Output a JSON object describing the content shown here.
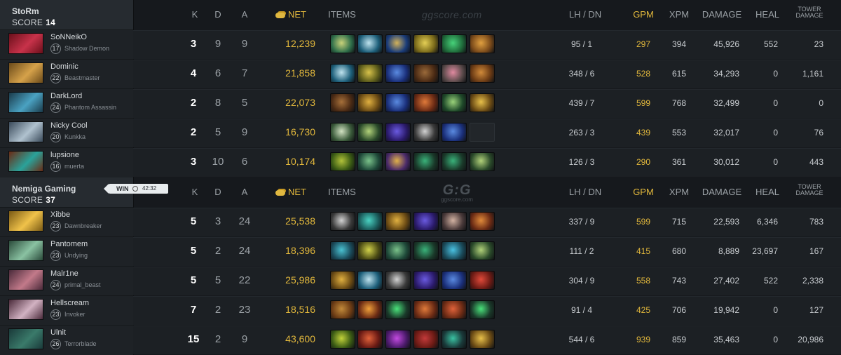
{
  "headers": {
    "k": "K",
    "d": "D",
    "a": "A",
    "net": "NET",
    "items": "ITEMS",
    "lhdn": "LH / DN",
    "gpm": "GPM",
    "xpm": "XPM",
    "damage": "DAMAGE",
    "heal": "HEAL",
    "tower_l1": "TOWER",
    "tower_l2": "DAMAGE"
  },
  "watermark": {
    "top": "ggscore.com",
    "logo": "G:G",
    "logo_sub": "ggscore.com"
  },
  "result": {
    "label": "WIN",
    "time": "42:32"
  },
  "teams": [
    {
      "name": "StoRm",
      "score_label": "SCORE",
      "score": "14",
      "players": [
        {
          "name": "SoNNeikO",
          "level": "17",
          "hero": "Shadow Demon",
          "k": "3",
          "d": "9",
          "a": "9",
          "net": "12,239",
          "lhdn": "95 / 1",
          "gpm": "297",
          "xpm": "394",
          "damage": "45,926",
          "heal": "552",
          "tower": "23",
          "avatar": [
            "#6a0f1a",
            "#c8324a"
          ],
          "items": [
            [
              "#2f6e4a",
              "#c9d27a"
            ],
            [
              "#1d5f7a",
              "#bfe3ee"
            ],
            [
              "#1a3c7a",
              "#d2b25a"
            ],
            [
              "#7a6a1a",
              "#e4cf55"
            ],
            [
              "#1f6a3a",
              "#47d27a"
            ],
            [
              "#7a4a1a",
              "#e0a040"
            ]
          ]
        },
        {
          "name": "Dominic",
          "level": "22",
          "hero": "Beastmaster",
          "k": "4",
          "d": "6",
          "a": "7",
          "net": "21,858",
          "lhdn": "348 / 6",
          "gpm": "528",
          "xpm": "615",
          "damage": "34,293",
          "heal": "0",
          "tower": "1,161",
          "avatar": [
            "#6a4a1a",
            "#d6a24a"
          ],
          "items": [
            [
              "#1d5f7a",
              "#bfe3ee"
            ],
            [
              "#5a5a1a",
              "#d7c24a"
            ],
            [
              "#1a2f7a",
              "#5a8ae0"
            ],
            [
              "#4a2a14",
              "#9a6a3a"
            ],
            [
              "#5a4a4a",
              "#e08aa0"
            ],
            [
              "#6a3a14",
              "#d08a3a"
            ]
          ]
        },
        {
          "name": "DarkLord",
          "level": "24",
          "hero": "Phantom Assassin",
          "k": "2",
          "d": "8",
          "a": "5",
          "net": "22,073",
          "lhdn": "439 / 7",
          "gpm": "599",
          "xpm": "768",
          "damage": "32,499",
          "heal": "0",
          "tower": "0",
          "avatar": [
            "#1a3a4a",
            "#4aa2c2"
          ],
          "items": [
            [
              "#4a2a14",
              "#a6703a"
            ],
            [
              "#6a4a14",
              "#e0b040"
            ],
            [
              "#1a2f7a",
              "#5a8ae0"
            ],
            [
              "#6a2a14",
              "#e07a3a"
            ],
            [
              "#1f4a2a",
              "#9ad27a"
            ],
            [
              "#6a4a14",
              "#e8c04a"
            ]
          ]
        },
        {
          "name": "Nicky Cool",
          "level": "20",
          "hero": "Kunkka",
          "k": "2",
          "d": "5",
          "a": "9",
          "net": "16,730",
          "lhdn": "263 / 3",
          "gpm": "439",
          "xpm": "553",
          "damage": "32,017",
          "heal": "0",
          "tower": "76",
          "avatar": [
            "#3a4a5a",
            "#b0c2cf"
          ],
          "items": [
            [
              "#3a5a3a",
              "#d2e2c2"
            ],
            [
              "#2a4a2a",
              "#b2d27a"
            ],
            [
              "#2a1a6a",
              "#6a5ae0"
            ],
            [
              "#3a3a3a",
              "#d2d2d2"
            ],
            [
              "#1a2f7a",
              "#5a8ae0"
            ],
            null
          ]
        },
        {
          "name": "lupsione",
          "level": "16",
          "hero": "muerta",
          "k": "3",
          "d": "10",
          "a": "6",
          "net": "10,174",
          "lhdn": "126 / 3",
          "gpm": "290",
          "xpm": "361",
          "damage": "30,012",
          "heal": "0",
          "tower": "443",
          "avatar": [
            "#6a2a14",
            "#2aa29a"
          ],
          "items": [
            [
              "#3a5a14",
              "#b2c23a"
            ],
            [
              "#1f4a3a",
              "#7ac28a"
            ],
            [
              "#4a2a6a",
              "#e0b04a"
            ],
            [
              "#1a3a2a",
              "#3ab27a"
            ],
            [
              "#1a3a2a",
              "#3ab27a"
            ],
            [
              "#2a4a2a",
              "#b2d27a"
            ]
          ]
        }
      ]
    },
    {
      "name": "Nemiga Gaming",
      "score_label": "SCORE",
      "score": "37",
      "players": [
        {
          "name": "Xibbe",
          "level": "23",
          "hero": "Dawnbreaker",
          "k": "5",
          "d": "3",
          "a": "24",
          "net": "25,538",
          "lhdn": "337 / 9",
          "gpm": "599",
          "xpm": "715",
          "damage": "22,593",
          "heal": "6,346",
          "tower": "783",
          "avatar": [
            "#7a5a14",
            "#f0c24a"
          ],
          "items": [
            [
              "#3a3a3a",
              "#d2d2d2"
            ],
            [
              "#1a5a5a",
              "#4ad2c2"
            ],
            [
              "#6a4a14",
              "#e0b040"
            ],
            [
              "#2a1a6a",
              "#6a5ae0"
            ],
            [
              "#4a3a3a",
              "#d2b2a2"
            ],
            [
              "#6a2a14",
              "#e08a3a"
            ]
          ]
        },
        {
          "name": "Pantomem",
          "level": "23",
          "hero": "Undying",
          "k": "5",
          "d": "2",
          "a": "24",
          "net": "18,396",
          "lhdn": "111 / 2",
          "gpm": "415",
          "xpm": "680",
          "damage": "8,889",
          "heal": "23,697",
          "tower": "167",
          "avatar": [
            "#2a4a3a",
            "#8ac2a2"
          ],
          "items": [
            [
              "#1a4a5a",
              "#4ac2d2"
            ],
            [
              "#4a4a14",
              "#d2d24a"
            ],
            [
              "#1f4a3a",
              "#7ac28a"
            ],
            [
              "#1a3a2a",
              "#3ab27a"
            ],
            [
              "#1a4a5a",
              "#4ac2e2"
            ],
            [
              "#2a4a2a",
              "#b2d27a"
            ]
          ]
        },
        {
          "name": "Malr1ne",
          "level": "24",
          "hero": "primal_beast",
          "k": "5",
          "d": "5",
          "a": "22",
          "net": "25,986",
          "lhdn": "304 / 9",
          "gpm": "558",
          "xpm": "743",
          "damage": "27,402",
          "heal": "522",
          "tower": "2,338",
          "avatar": [
            "#4a2a3a",
            "#c27a8a"
          ],
          "items": [
            [
              "#6a4a14",
              "#e0b040"
            ],
            [
              "#1d5f7a",
              "#bfe3ee"
            ],
            [
              "#3a3a3a",
              "#d2d2d2"
            ],
            [
              "#2a1a6a",
              "#6a5ae0"
            ],
            [
              "#1a2f7a",
              "#5a8ae0"
            ],
            [
              "#6a1a14",
              "#e04a3a"
            ]
          ]
        },
        {
          "name": "Hellscream",
          "level": "23",
          "hero": "Invoker",
          "k": "7",
          "d": "2",
          "a": "23",
          "net": "18,516",
          "lhdn": "91 / 4",
          "gpm": "425",
          "xpm": "706",
          "damage": "19,942",
          "heal": "0",
          "tower": "127",
          "avatar": [
            "#4a2a3a",
            "#d2b2c2"
          ],
          "items": [
            [
              "#6a3a14",
              "#c28a3a"
            ],
            [
              "#6a2a14",
              "#f0a03a"
            ],
            [
              "#1a3a2a",
              "#4ae27a"
            ],
            [
              "#6a2a14",
              "#e07a3a"
            ],
            [
              "#6a2a14",
              "#e0623a"
            ],
            [
              "#1a3a2a",
              "#4ae27a"
            ]
          ]
        },
        {
          "name": "Ulnit",
          "level": "26",
          "hero": "Terrorblade",
          "k": "15",
          "d": "2",
          "a": "9",
          "net": "43,600",
          "lhdn": "544 / 6",
          "gpm": "939",
          "xpm": "859",
          "damage": "35,463",
          "heal": "0",
          "tower": "20,986",
          "avatar": [
            "#1a3a3a",
            "#3a7a6a"
          ],
          "items": [
            [
              "#3a5a14",
              "#c2d23a"
            ],
            [
              "#6a1a14",
              "#e0623a"
            ],
            [
              "#4a1a6a",
              "#c24ae0"
            ],
            [
              "#6a1a14",
              "#c23a3a"
            ],
            [
              "#1a3a3a",
              "#3ac2a2"
            ],
            [
              "#6a4a14",
              "#e8c04a"
            ]
          ]
        }
      ]
    }
  ]
}
